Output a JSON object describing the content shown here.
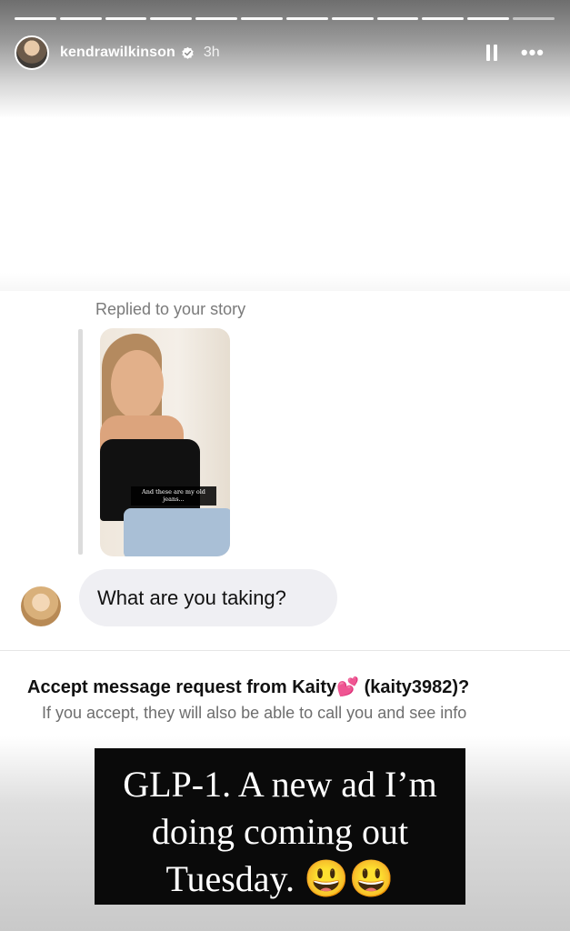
{
  "story": {
    "segments": 12,
    "username": "kendrawilkinson",
    "time": "3h",
    "icons": {
      "verified": "verified-badge-icon",
      "pause": "pause-icon",
      "more": "more-options-icon"
    }
  },
  "reply": {
    "replied_label": "Replied to your story",
    "story_caption": "And these are my old jeans...",
    "message": "What are you taking?"
  },
  "request": {
    "title_prefix": "Accept message request from Kaity",
    "title_emoji": "💕",
    "title_suffix": " (kaity3982)?",
    "body": "If you accept, they will also be able to call you and see info"
  },
  "caption": {
    "line1": "GLP-1.  A new ad I’m",
    "line2": "doing coming out",
    "line3": "Tuesday. 😃😃"
  },
  "colors": {
    "bubble": "#efeff3",
    "caption_bg": "#0a0a0a",
    "verified": "#3897f0"
  }
}
